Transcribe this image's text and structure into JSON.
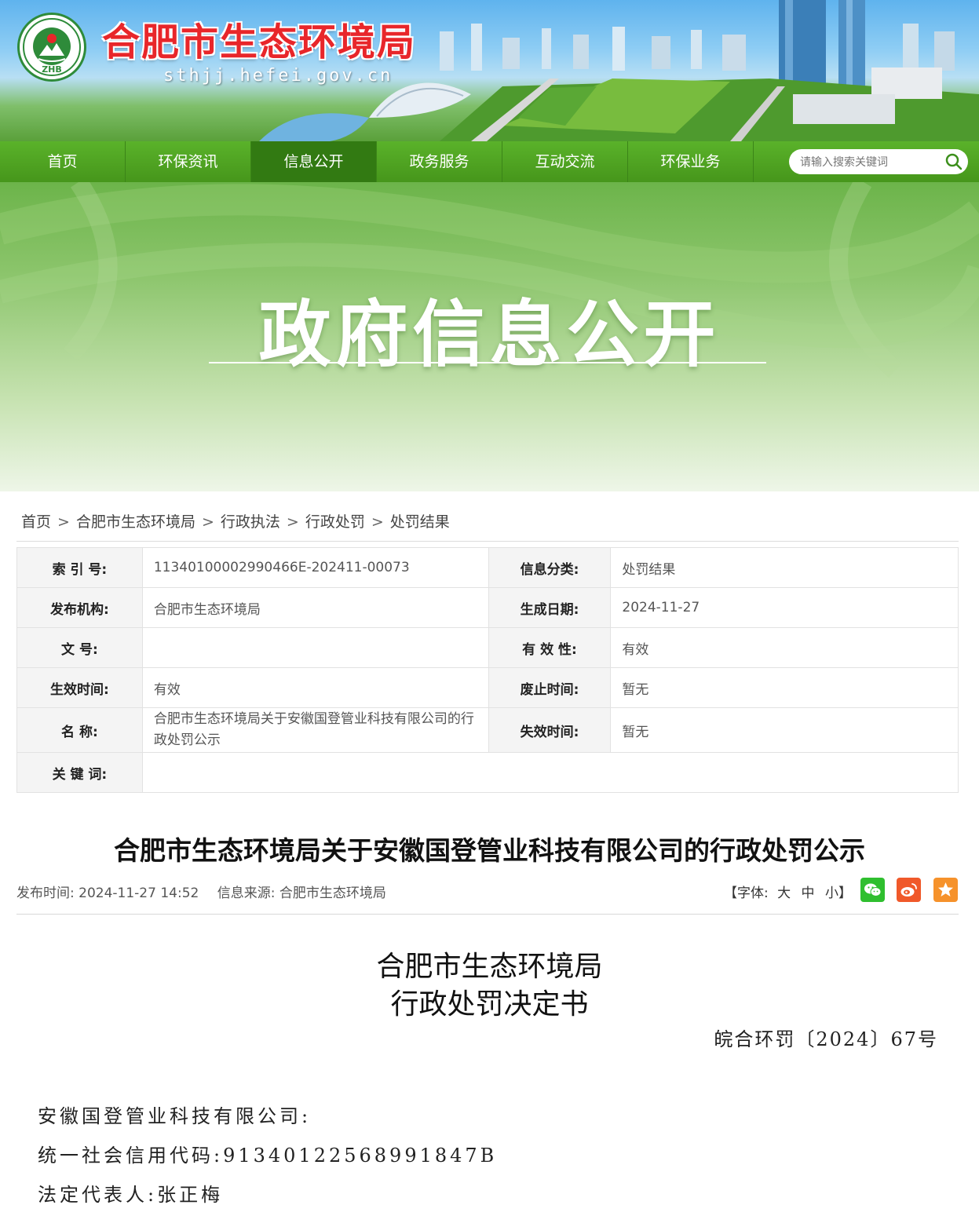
{
  "header": {
    "logo_text": "ZHB",
    "site_title": "合肥市生态环境局",
    "site_domain": "sthjj.hefei.gov.cn"
  },
  "nav": {
    "items": [
      {
        "label": "首页"
      },
      {
        "label": "环保资讯"
      },
      {
        "label": "信息公开"
      },
      {
        "label": "政务服务"
      },
      {
        "label": "互动交流"
      },
      {
        "label": "环保业务"
      }
    ],
    "active_index": 2,
    "search_placeholder": "请输入搜索关键词"
  },
  "banner": {
    "title": "政府信息公开"
  },
  "breadcrumb": [
    "首页",
    "合肥市生态环境局",
    "行政执法",
    "行政处罚",
    "处罚结果"
  ],
  "breadcrumb_separator": ">",
  "meta": {
    "rows": [
      {
        "l1": "索  引  号:",
        "v1": "11340100002990466E-202411-00073",
        "l2": "信息分类:",
        "v2": "处罚结果"
      },
      {
        "l1": "发布机构:",
        "v1": "合肥市生态环境局",
        "l2": "生成日期:",
        "v2": "2024-11-27"
      },
      {
        "l1": "文        号:",
        "v1": "",
        "l2": "有  效  性:",
        "v2": "有效"
      },
      {
        "l1": "生效时间:",
        "v1": "有效",
        "l2": "废止时间:",
        "v2": "暂无"
      },
      {
        "l1": "名        称:",
        "v1": "合肥市生态环境局关于安徽国登管业科技有限公司的行政处罚公示",
        "l2": "失效时间:",
        "v2": "暂无"
      },
      {
        "l1": "关  键  词:",
        "v1": ""
      }
    ]
  },
  "article": {
    "title": "合肥市生态环境局关于安徽国登管业科技有限公司的行政处罚公示",
    "publish_label": "发布时间:",
    "publish_time": "2024-11-27 14:52",
    "source_label": "信息来源:",
    "source": "合肥市生态环境局",
    "font_label": "【字体:",
    "font_large": "大",
    "font_medium": "中",
    "font_small": "小】",
    "share": [
      {
        "icon": "wechat-icon",
        "color": "#2fbf2f"
      },
      {
        "icon": "weibo-icon",
        "color": "#f0592a"
      },
      {
        "icon": "favorite-star-icon",
        "color": "#f6922b"
      }
    ]
  },
  "document": {
    "org": "合肥市生态环境局",
    "type": "行政处罚决定书",
    "number": "皖合环罚〔2024〕67号",
    "lines": [
      "安徽国登管业科技有限公司:",
      "统一社会信用代码:913401225689918​47B",
      "法定代表人:张正梅"
    ]
  }
}
